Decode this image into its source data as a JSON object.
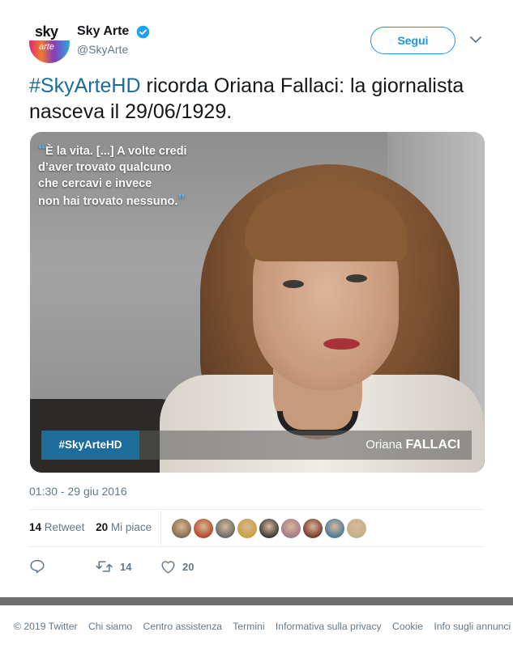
{
  "account": {
    "avatar_text_top": "sky",
    "avatar_text_bottom": "arte",
    "display_name": "Sky Arte",
    "handle": "@SkyArte",
    "verified": true
  },
  "follow_label": "Segui",
  "tweet": {
    "hashtag": "#SkyArteHD",
    "text": " ricorda Oriana Fallaci: la giornalista nasceva il 29/06/1929."
  },
  "media": {
    "quote_lines": [
      "È la vita. [...] A volte credi",
      "d’aver trovato qualcuno",
      "che cercavi e invece",
      "non hai trovato nessuno."
    ],
    "caption_hashtag": "#SkyArteHD",
    "caption_first": "Oriana",
    "caption_last": "FALLACI"
  },
  "timestamp": "01:30 - 29 giu 2016",
  "stats": {
    "retweets_count": "14",
    "retweets_label": "Retweet",
    "likes_count": "20",
    "likes_label": "Mi piace"
  },
  "likers": [
    "#8a6a4a",
    "#b34a2a",
    "#6a6a6a",
    "#c9a13a",
    "#3a3a3a",
    "#a07a8a",
    "#7a3a2a",
    "#4a7a9a",
    "#c4b08a"
  ],
  "actions": {
    "reply_icon": "reply-icon",
    "retweet_count": "14",
    "like_count": "20"
  },
  "colors": {
    "accent": "#1b95e0",
    "hashtag": "#1b6b9c"
  },
  "footer": [
    "© 2019 Twitter",
    "Chi siamo",
    "Centro assistenza",
    "Termini",
    "Informativa sulla privacy",
    "Cookie",
    "Info sugli annunci"
  ]
}
